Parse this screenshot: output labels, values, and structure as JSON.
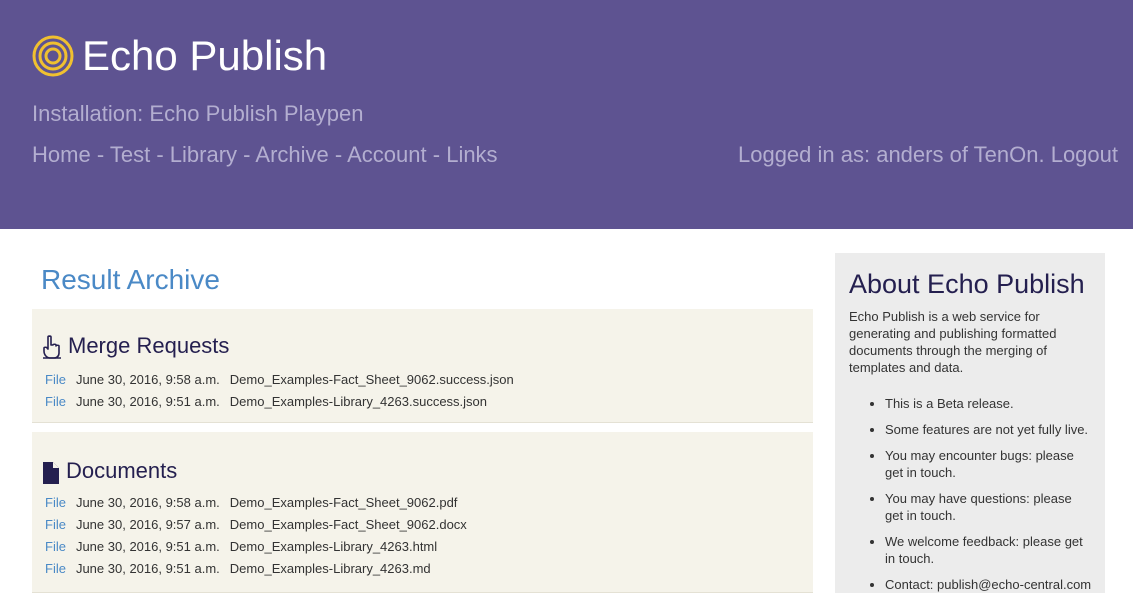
{
  "header": {
    "site_title": "Echo Publish",
    "installation": "Installation: Echo Publish Playpen",
    "nav": [
      "Home",
      "Test",
      "Library",
      "Archive",
      "Account",
      "Links"
    ],
    "separator": "-",
    "login_text": "Logged in as: anders of TenOn.",
    "logout_label": "Logout"
  },
  "main": {
    "page_title": "Result Archive",
    "merge_requests": {
      "title": "Merge Requests",
      "rows": [
        {
          "link": "File",
          "date": "June 30, 2016, 9:58 a.m.",
          "name": "Demo_Examples-Fact_Sheet_9062.success.json"
        },
        {
          "link": "File",
          "date": "June 30, 2016, 9:51 a.m.",
          "name": "Demo_Examples-Library_4263.success.json"
        }
      ]
    },
    "documents": {
      "title": "Documents",
      "rows": [
        {
          "link": "File",
          "date": "June 30, 2016, 9:58 a.m.",
          "name": "Demo_Examples-Fact_Sheet_9062.pdf"
        },
        {
          "link": "File",
          "date": "June 30, 2016, 9:57 a.m.",
          "name": "Demo_Examples-Fact_Sheet_9062.docx"
        },
        {
          "link": "File",
          "date": "June 30, 2016, 9:51 a.m.",
          "name": "Demo_Examples-Library_4263.html"
        },
        {
          "link": "File",
          "date": "June 30, 2016, 9:51 a.m.",
          "name": "Demo_Examples-Library_4263.md"
        }
      ]
    }
  },
  "sidebar": {
    "title": "About Echo Publish",
    "text": "Echo Publish is a web service for generating and publishing formatted documents through the merging of templates and data.",
    "items": [
      "This is a Beta release.",
      "Some features are not yet fully live.",
      "You may encounter bugs: please get in touch.",
      "You may have questions: please get in touch.",
      "We welcome feedback: please get in touch.",
      "Contact: publish@echo-central.com"
    ]
  },
  "icons": {
    "logo": "concentric-rings-logo-icon",
    "merge_requests": "hand-pointer-icon",
    "documents": "document-icon"
  },
  "colors": {
    "header_bg": "#5e5391",
    "header_text_muted": "#b3aed0",
    "logo": "#f0c030",
    "link": "#4a89c6",
    "heading_dark": "#241f4f",
    "panel_bg": "#f5f3ea",
    "sidebar_bg": "#ececec"
  }
}
